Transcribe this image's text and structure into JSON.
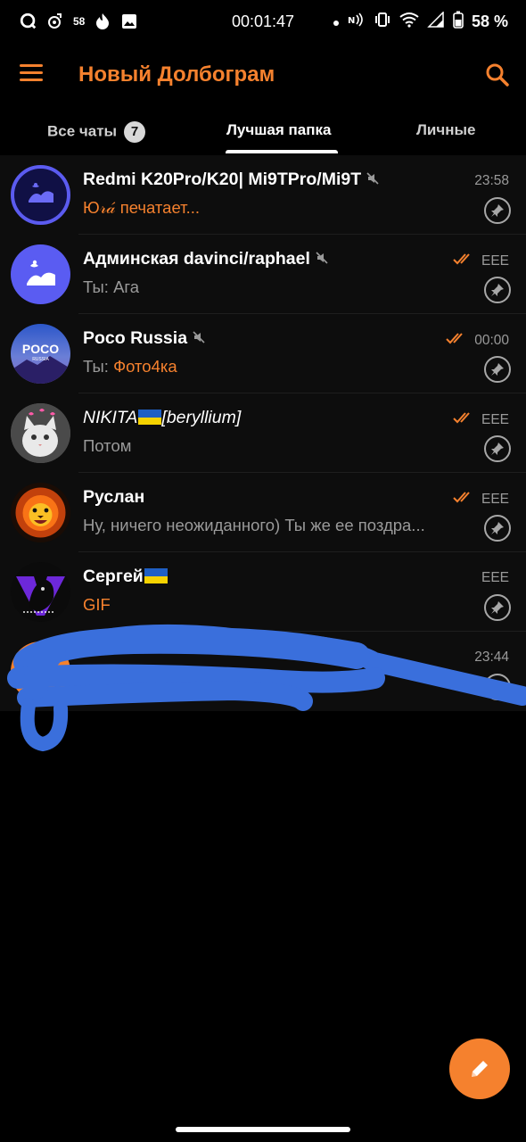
{
  "status_bar": {
    "notification_count": "58",
    "time": "00:01:47",
    "battery": "58 %"
  },
  "app_bar": {
    "title": "Новый Долбограм"
  },
  "tabs": [
    {
      "label": "Все чаты",
      "badge": "7"
    },
    {
      "label": "Лучшая папка",
      "active": true
    },
    {
      "label": "Личные"
    }
  ],
  "chats": [
    {
      "name": "Redmi K20Pro/K20| Mi9TPro/Mi9T",
      "muted": true,
      "preview_sender": "",
      "preview": "Ю𝓇𝒶́ печатает...",
      "time": "23:58",
      "read_ticks": false,
      "avatar": "redmi-group-avatar"
    },
    {
      "name": "Админская davinci/raphael",
      "muted": true,
      "preview_sender": "Ты: ",
      "preview": "Ага",
      "time": "ЕЕЕ",
      "read_ticks": true,
      "avatar": "admin-group-avatar"
    },
    {
      "name": "Poco Russia",
      "muted": true,
      "preview_sender": "Ты: ",
      "preview": "Фото4ка",
      "time": "00:00",
      "read_ticks": true,
      "avatar": "poco-avatar",
      "avatar_text": "POCO",
      "avatar_subtext": "RUSSIA"
    },
    {
      "name_prefix": "NIKITA",
      "name_suffix": "[beryllium]",
      "muted": false,
      "preview_sender": "",
      "preview": "Потом",
      "time": "ЕЕЕ",
      "read_ticks": true,
      "avatar": "cat-avatar"
    },
    {
      "name": "Руслан",
      "muted": false,
      "preview_sender": "",
      "preview": "Ну, ничего неожиданного) Ты же ее поздра...",
      "time": "ЕЕЕ",
      "read_ticks": true,
      "avatar": "lion-avatar"
    },
    {
      "name": "Сергей",
      "muted": false,
      "preview_sender": "",
      "preview": "GIF",
      "time": "ЕЕЕ",
      "read_ticks": false,
      "avatar": "panther-avatar"
    },
    {
      "name": "",
      "preview": "",
      "time": "23:44",
      "avatar": "hidden-avatar"
    }
  ],
  "colors": {
    "accent": "#f5812e",
    "background": "#000000",
    "row": "#0d0d0d",
    "scribble": "#3a6fdc"
  }
}
